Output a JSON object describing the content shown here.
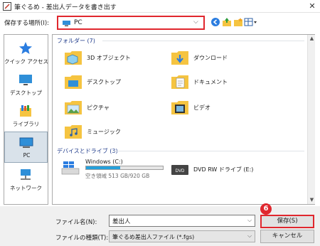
{
  "window": {
    "title": "筆ぐるめ - 差出人データを書き出す",
    "close_glyph": "✕"
  },
  "location": {
    "label": "保存する場所(I):",
    "value": "PC",
    "chevron": "⌵"
  },
  "toolbar": {
    "icons": [
      "back-icon",
      "up-folder-icon",
      "new-folder-icon",
      "view-menu-icon"
    ]
  },
  "sidebar": {
    "items": [
      {
        "label": "クイック アクセス",
        "icon": "quick-access-star-icon"
      },
      {
        "label": "デスクトップ",
        "icon": "desktop-icon"
      },
      {
        "label": "ライブラリ",
        "icon": "library-icon"
      },
      {
        "label": "PC",
        "icon": "pc-icon",
        "selected": true
      },
      {
        "label": "ネットワーク",
        "icon": "network-icon"
      }
    ]
  },
  "main": {
    "folders_header": "フォルダー (7)",
    "folders": [
      {
        "label": "3D オブジェクト",
        "icon": "3d-objects-folder-icon"
      },
      {
        "label": "ダウンロード",
        "icon": "downloads-folder-icon"
      },
      {
        "label": "デスクトップ",
        "icon": "desktop-folder-icon"
      },
      {
        "label": "ドキュメント",
        "icon": "documents-folder-icon"
      },
      {
        "label": "ピクチャ",
        "icon": "pictures-folder-icon"
      },
      {
        "label": "ビデオ",
        "icon": "videos-folder-icon"
      },
      {
        "label": "ミュージック",
        "icon": "music-folder-icon"
      }
    ],
    "drives_header": "デバイスとドライブ (3)",
    "drives": [
      {
        "label": "Windows (C:)",
        "free": "空き領域 513 GB/920 GB",
        "used_fraction": 0.44,
        "icon": "windows-drive-icon"
      },
      {
        "label": "DVD RW ドライブ (E:)",
        "icon": "dvd-drive-icon"
      }
    ]
  },
  "form": {
    "filename_label": "ファイル名(N):",
    "filename_value": "差出人",
    "filetype_label": "ファイルの種類(T):",
    "filetype_value": "筆ぐるめ差出人ファイル (*.fgs)",
    "save_label": "保存(S)",
    "cancel_label": "キャンセル",
    "step_badge": "6"
  },
  "colors": {
    "highlight_red": "#e0272e",
    "folder_yellow": "#f5c441",
    "accent_blue": "#26a0da"
  }
}
